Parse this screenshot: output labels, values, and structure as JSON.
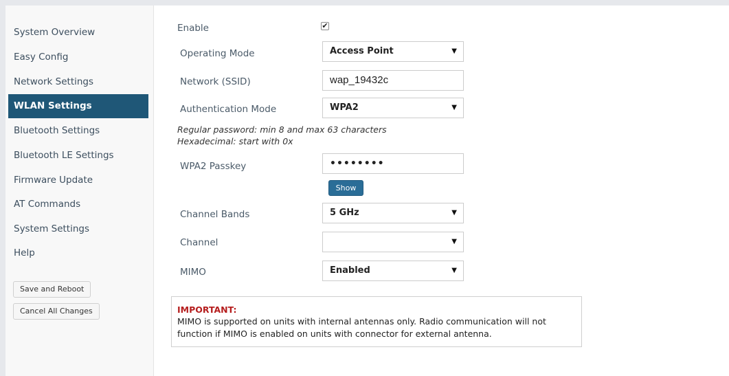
{
  "sidebar": {
    "items": [
      {
        "label": "System Overview"
      },
      {
        "label": "Easy Config"
      },
      {
        "label": "Network Settings"
      },
      {
        "label": "WLAN Settings",
        "active": true
      },
      {
        "label": "Bluetooth Settings"
      },
      {
        "label": "Bluetooth LE Settings"
      },
      {
        "label": "Firmware Update"
      },
      {
        "label": "AT Commands"
      },
      {
        "label": "System Settings"
      },
      {
        "label": "Help"
      }
    ],
    "save_reboot_label": "Save and Reboot",
    "cancel_changes_label": "Cancel All Changes"
  },
  "form": {
    "enable": {
      "label": "Enable",
      "checked": true
    },
    "operating_mode": {
      "label": "Operating Mode",
      "value": "Access Point"
    },
    "ssid": {
      "label": "Network (SSID)",
      "value": "wap_19432c"
    },
    "auth_mode": {
      "label": "Authentication Mode",
      "value": "WPA2"
    },
    "hint_line1": "Regular password: min 8 and max 63 characters",
    "hint_line2": "Hexadecimal: start with 0x",
    "passkey": {
      "label": "WPA2 Passkey",
      "value": "••••••••"
    },
    "show_label": "Show",
    "channel_bands": {
      "label": "Channel Bands",
      "value": "5 GHz"
    },
    "channel": {
      "label": "Channel",
      "value": ""
    },
    "mimo": {
      "label": "MIMO",
      "value": "Enabled"
    }
  },
  "notice": {
    "title": "IMPORTANT:",
    "line1": "MIMO is supported on units with internal antennas only. Radio communication will not",
    "line2": "function if MIMO is enabled on units with connector for external antenna."
  },
  "colors": {
    "active_nav_bg": "#1f5777",
    "button_blue": "#2a6d97",
    "important_red": "#b51d1d"
  }
}
